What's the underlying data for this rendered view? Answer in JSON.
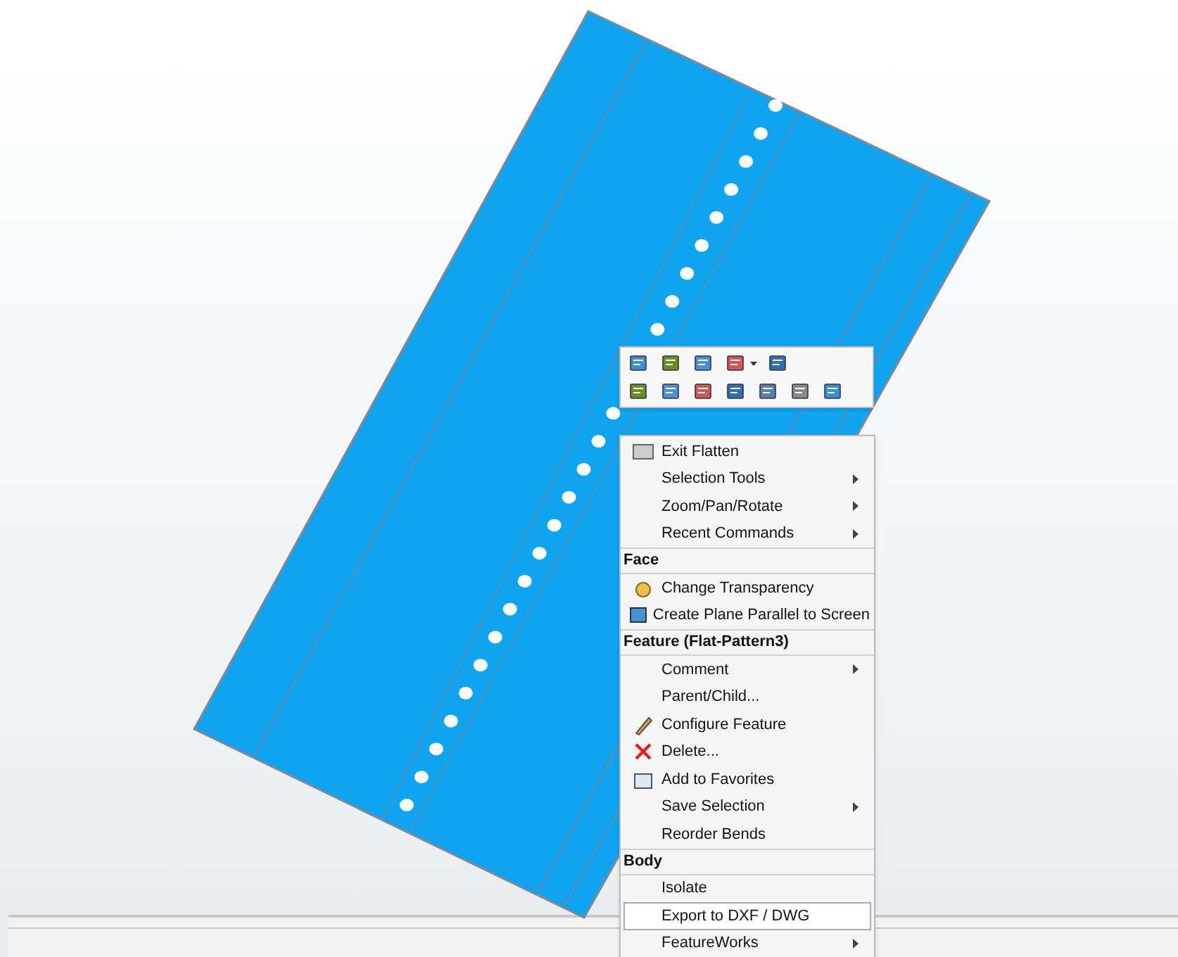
{
  "toolbar": {
    "rows": [
      {
        "buttons": [
          {
            "kind": "icon"
          },
          {
            "kind": "icon"
          },
          {
            "kind": "icon"
          },
          {
            "kind": "dropdown"
          },
          {
            "kind": "icon"
          }
        ]
      },
      {
        "buttons": [
          {
            "kind": "icon"
          },
          {
            "kind": "icon"
          },
          {
            "kind": "icon"
          },
          {
            "kind": "icon"
          },
          {
            "kind": "icon"
          },
          {
            "kind": "icon"
          },
          {
            "kind": "icon"
          }
        ]
      }
    ]
  },
  "context_menu": {
    "items": [
      {
        "kind": "item",
        "label": "Exit Flatten",
        "icon": true,
        "submenu": false,
        "selected": false
      },
      {
        "kind": "item",
        "label": "Selection Tools",
        "submenu": true,
        "selected": false
      },
      {
        "kind": "item",
        "label": "Zoom/Pan/Rotate",
        "submenu": true,
        "selected": false
      },
      {
        "kind": "item",
        "label": "Recent Commands",
        "submenu": true,
        "selected": false
      },
      {
        "kind": "header",
        "label": "Face"
      },
      {
        "kind": "item",
        "label": "Change Transparency",
        "icon": true,
        "submenu": false,
        "selected": false
      },
      {
        "kind": "item",
        "label": "Create Plane Parallel to Screen",
        "icon": true,
        "submenu": false,
        "selected": false
      },
      {
        "kind": "header",
        "label": "Feature (Flat-Pattern3)"
      },
      {
        "kind": "item",
        "label": "Comment",
        "submenu": true,
        "selected": false
      },
      {
        "kind": "item",
        "label": "Parent/Child...",
        "submenu": false,
        "selected": false
      },
      {
        "kind": "item",
        "label": "Configure Feature",
        "icon": true,
        "submenu": false,
        "selected": false
      },
      {
        "kind": "item",
        "label": "Delete...",
        "icon": true,
        "submenu": false,
        "selected": false
      },
      {
        "kind": "item",
        "label": "Add to Favorites",
        "icon": true,
        "submenu": false,
        "selected": false
      },
      {
        "kind": "item",
        "label": "Save Selection",
        "submenu": true,
        "selected": false
      },
      {
        "kind": "item",
        "label": "Reorder Bends",
        "submenu": false,
        "selected": false
      },
      {
        "kind": "header",
        "label": "Body"
      },
      {
        "kind": "item",
        "label": "Isolate",
        "submenu": false,
        "selected": false
      },
      {
        "kind": "item",
        "label": "Export to DXF / DWG",
        "submenu": false,
        "selected": true
      },
      {
        "kind": "item",
        "label": "FeatureWorks",
        "submenu": true,
        "selected": false
      }
    ]
  }
}
